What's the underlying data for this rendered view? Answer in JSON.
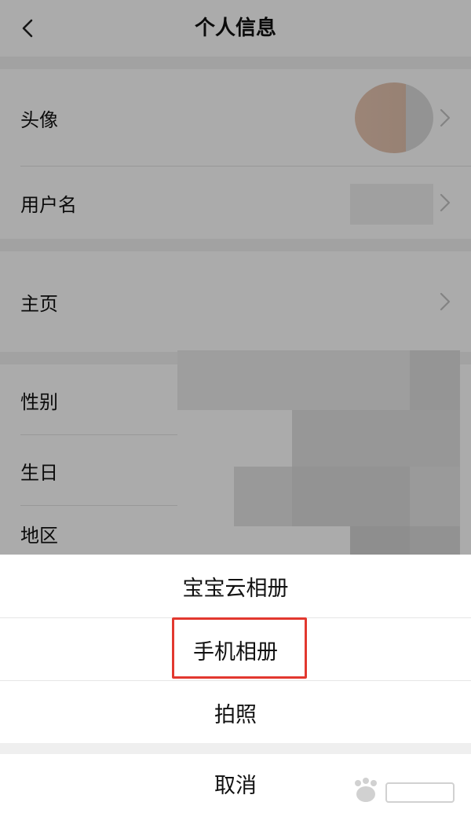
{
  "nav": {
    "title": "个人信息",
    "back_icon": "chevron-left-icon"
  },
  "profile": {
    "rows": [
      {
        "label": "头像"
      },
      {
        "label": "用户名"
      },
      {
        "label": "主页"
      },
      {
        "label": "性别"
      },
      {
        "label": "生日"
      },
      {
        "label": "地区"
      }
    ]
  },
  "action_sheet": {
    "options": [
      "宝宝云相册",
      "手机相册",
      "拍照"
    ],
    "cancel_label": "取消",
    "highlighted_option": "手机相册"
  },
  "colors": {
    "highlight": "#e2382f",
    "overlay": "rgba(0,0,0,0.33)"
  }
}
